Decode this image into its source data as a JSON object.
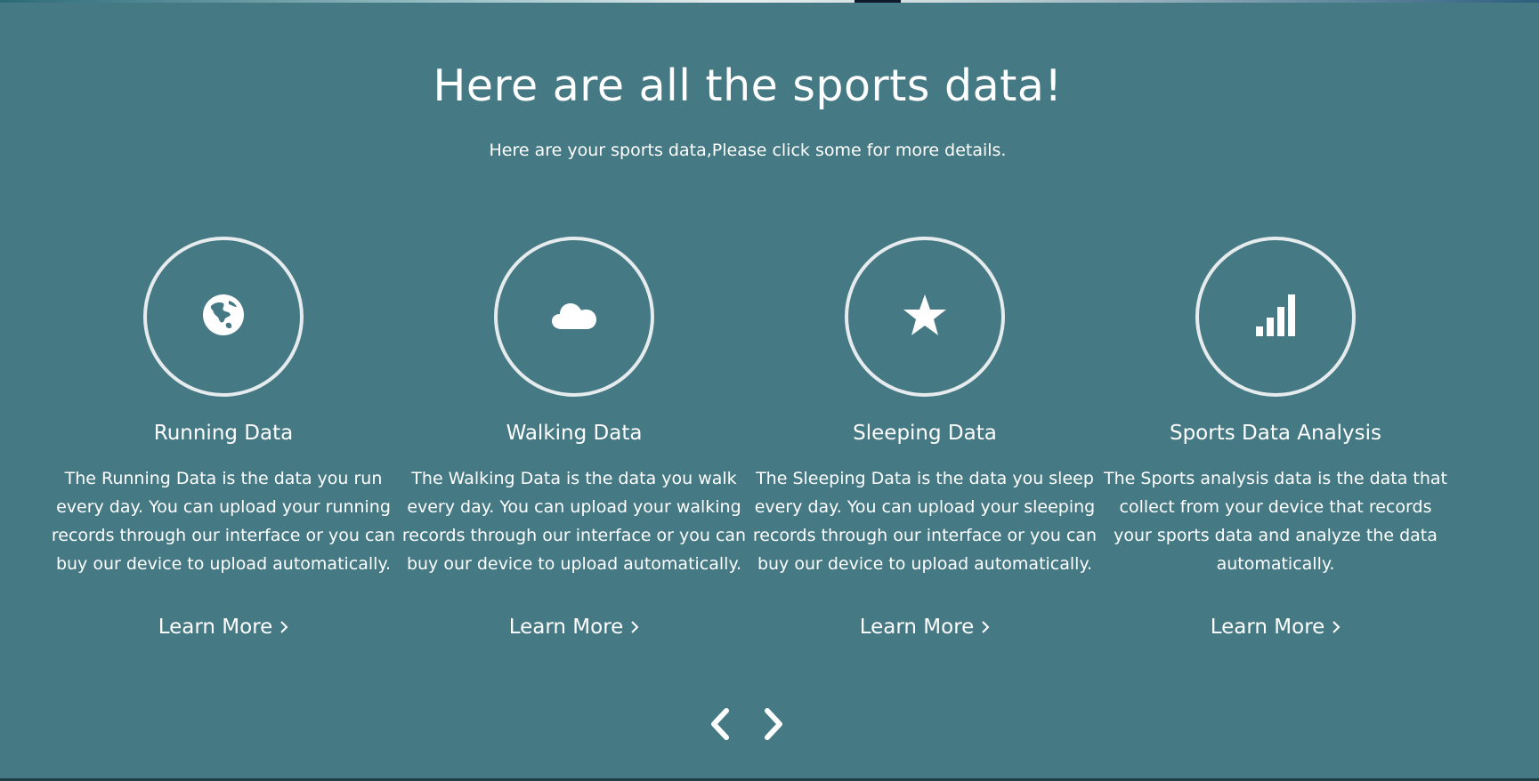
{
  "header": {
    "title": "Here are all the sports data!",
    "subtitle": "Here are your sports data,Please click some for more details."
  },
  "cards": [
    {
      "icon": "globe-icon",
      "title": "Running Data",
      "description": "The Running Data is the data you run every day. You can upload your running records through our interface or you can buy our device to upload automatically.",
      "link_label": "Learn More"
    },
    {
      "icon": "cloud-icon",
      "title": "Walking Data",
      "description": "The Walking Data is the data you walk every day. You can upload your walking records through our interface or you can buy our device to upload automatically.",
      "link_label": "Learn More"
    },
    {
      "icon": "star-icon",
      "title": "Sleeping Data",
      "description": "The Sleeping Data is the data you sleep every day. You can upload your sleeping records through our interface or you can buy our device to upload automatically.",
      "link_label": "Learn More"
    },
    {
      "icon": "signal-bars-icon",
      "title": "Sports Data Analysis",
      "description": "The Sports analysis data is the data that collect from your device that records your sports data and analyze the data automatically.",
      "link_label": "Learn More"
    }
  ],
  "carousel": {
    "prev_icon": "chevron-left-icon",
    "next_icon": "chevron-right-icon"
  },
  "colors": {
    "background": "#457984",
    "text": "#ffffff",
    "circle_border": "#e6ecee"
  }
}
